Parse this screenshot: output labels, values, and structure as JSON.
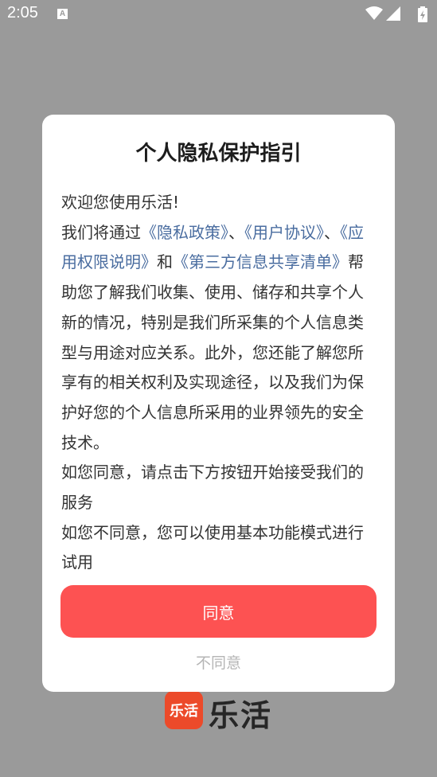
{
  "status_bar": {
    "time": "2:05",
    "notification_icon_letter": "A"
  },
  "background": {
    "app_logo_text": "乐活",
    "app_name": "乐活"
  },
  "dialog": {
    "title": "个人隐私保护指引",
    "welcome": "欢迎您使用乐活!",
    "intro_prefix": "我们将通过",
    "link_privacy": "《隐私政策》",
    "sep1": "、",
    "link_user_agreement": "《用户协议》",
    "sep2": "、",
    "link_permissions": "《应用权限说明》",
    "sep3": "和",
    "link_third_party": "《第三方信息共享清单》",
    "intro_suffix": "帮助您了解我们收集、使用、储存和共享个人新的情况，特别是我们所采集的个人信息类型与用途对应关系。此外，您还能了解您所享有的相关权利及实现途径，以及我们为保护好您的个人信息所采用的业界领先的安全技术。",
    "agree_note": "如您同意，请点击下方按钮开始接受我们的服务",
    "disagree_note": "如您不同意，您可以使用基本功能模式进行试用",
    "agree_button": "同意",
    "disagree_button": "不同意"
  },
  "colors": {
    "overlay": "#9a9a9a",
    "link": "#4a6da0",
    "agree_button": "#fd5252",
    "disagree_text": "#b5b5b5"
  },
  "icons": [
    "wifi-icon",
    "signal-icon",
    "battery-icon",
    "notification-a-icon"
  ]
}
